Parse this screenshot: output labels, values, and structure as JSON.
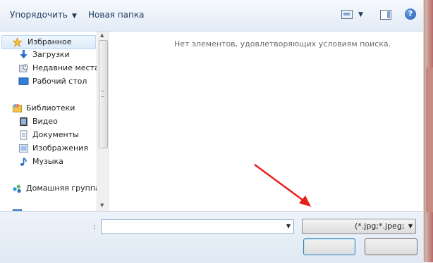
{
  "toolbar": {
    "organize_label": "Упорядочить",
    "new_folder_label": "Новая папка",
    "help_glyph": "?"
  },
  "sidebar": {
    "favorites": {
      "label": "Избранное",
      "icon": "star-icon",
      "items": [
        {
          "label": "Загрузки",
          "icon": "downloads-icon"
        },
        {
          "label": "Недавние места",
          "icon": "recent-places-icon"
        },
        {
          "label": "Рабочий стол",
          "icon": "desktop-icon"
        }
      ]
    },
    "libraries": {
      "label": "Библиотеки",
      "icon": "libraries-icon",
      "items": [
        {
          "label": "Видео",
          "icon": "video-icon"
        },
        {
          "label": "Документы",
          "icon": "documents-icon"
        },
        {
          "label": "Изображения",
          "icon": "images-icon"
        },
        {
          "label": "Музыка",
          "icon": "music-icon"
        }
      ]
    },
    "homegroup": {
      "label": "Домашняя группа",
      "icon": "homegroup-icon"
    }
  },
  "content": {
    "empty_message": "Нет элементов, удовлетворяющих условиям поиска."
  },
  "bottom": {
    "filename_label": ":",
    "filename_value": "",
    "filetype_value": "(*.jpg;*.jpeg;*.p",
    "open_label": "",
    "cancel_label": ""
  },
  "colors": {
    "annotation_arrow": "#e8201c",
    "toolbar_text": "#1e395b",
    "selection_border": "#b8d6fb"
  }
}
